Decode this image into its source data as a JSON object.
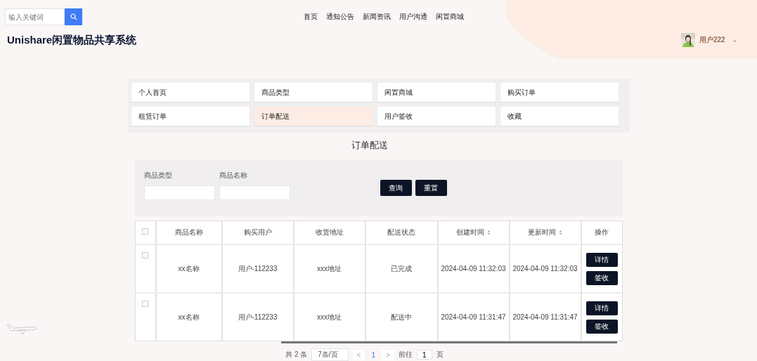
{
  "header": {
    "search": {
      "placeholder": "输入关键词"
    },
    "nav": [
      {
        "label": "首页",
        "selected": false
      },
      {
        "label": "通知公告",
        "selected": false
      },
      {
        "label": "新闻资讯",
        "selected": false
      },
      {
        "label": "用户沟通",
        "selected": false
      },
      {
        "label": "闲置商城",
        "selected": false
      }
    ],
    "title": "Unishare闲置物品共享系统",
    "user": {
      "name": "用户222",
      "caret": "-"
    }
  },
  "menu": [
    {
      "label": "个人首页",
      "selected": false
    },
    {
      "label": "商品类型",
      "selected": false
    },
    {
      "label": "闲置商城",
      "selected": false
    },
    {
      "label": "购买订单",
      "selected": false
    },
    {
      "label": "租赁订单",
      "selected": false
    },
    {
      "label": "订单配送",
      "selected": true
    },
    {
      "label": "用户签收",
      "selected": false
    },
    {
      "label": "收藏",
      "selected": false
    }
  ],
  "page_title": "订单配送",
  "filters": [
    {
      "label": "商品类型"
    },
    {
      "label": "商品名称"
    }
  ],
  "filter_buttons": [
    "查询",
    "重置"
  ],
  "table": {
    "columns": [
      {
        "label": "商品名称",
        "sortable": false
      },
      {
        "label": "购买用户",
        "sortable": false
      },
      {
        "label": "收货地址",
        "sortable": false
      },
      {
        "label": "配送状态",
        "sortable": false
      },
      {
        "label": "创建时间",
        "sortable": true
      },
      {
        "label": "更新时间",
        "sortable": true
      },
      {
        "label": "操作",
        "sortable": false
      }
    ],
    "header_checked": false,
    "rows": [
      {
        "checked": false,
        "cells": [
          "xx名称",
          "用户-112233",
          "xxx地址",
          "已完成",
          "2024-04-09 11:32:03",
          "2024-04-09 11:32:03"
        ],
        "actions": [
          "详情",
          "签收"
        ]
      },
      {
        "checked": false,
        "cells": [
          "xx名称",
          "用户-112233",
          "xxx地址",
          "配送中",
          "2024-04-09 11:31:47",
          "2024-04-09 11:31:47"
        ],
        "actions": [
          "详情",
          "签收"
        ]
      }
    ]
  },
  "pagination": {
    "total": "共 2 条",
    "page_size": "7条/页",
    "prev": "<",
    "pages": [
      {
        "label": "1",
        "selected": true
      }
    ],
    "next": ">",
    "goto_label": "前往",
    "goto_value": "1",
    "goto_suffix": "页"
  }
}
